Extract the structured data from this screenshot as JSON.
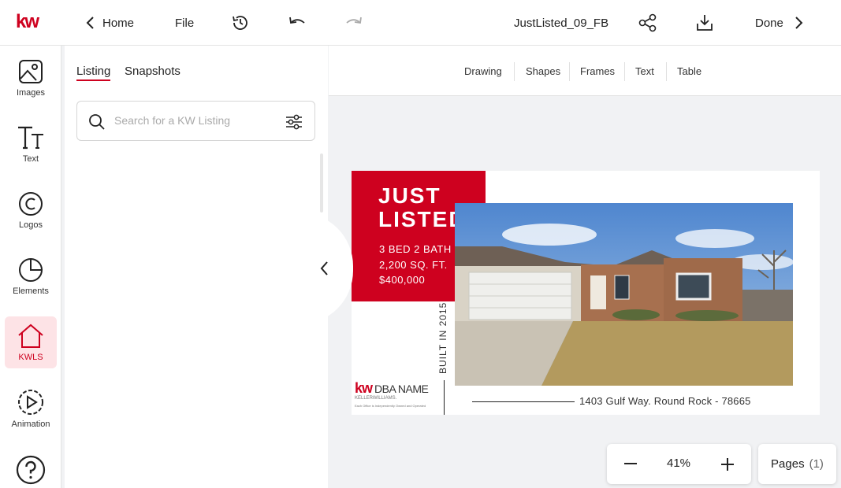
{
  "brand": {
    "logo": "kw",
    "accent": "#ce011f"
  },
  "topbar": {
    "home_label": "Home",
    "file_label": "File",
    "document_name": "JustListed_09_FB",
    "done_label": "Done"
  },
  "rail": {
    "items": [
      {
        "label": "Images",
        "icon": "image-icon"
      },
      {
        "label": "Text",
        "icon": "text-icon"
      },
      {
        "label": "Logos",
        "icon": "copyright-icon"
      },
      {
        "label": "Elements",
        "icon": "pie-icon"
      },
      {
        "label": "KWLS",
        "icon": "home-icon",
        "active": true
      },
      {
        "label": "Animation",
        "icon": "play-icon"
      },
      {
        "label": "",
        "icon": "help-icon"
      }
    ]
  },
  "panel": {
    "tabs": [
      {
        "label": "Listing",
        "active": true
      },
      {
        "label": "Snapshots"
      }
    ],
    "search_placeholder": "Search for a KW Listing"
  },
  "canvas_toolbar": {
    "items": [
      "Drawing",
      "Shapes",
      "Frames",
      "Text",
      "Table"
    ]
  },
  "flyer": {
    "headline1": "JUST",
    "headline2": "LISTED",
    "details": [
      "3 BED 2 BATH",
      "2,200 SQ. FT.",
      "$400,000"
    ],
    "built": "BUILT IN 2015",
    "address": "1403 Gulf Way. Round Rock - 78665",
    "logo_kw": "kw",
    "dba_name": "DBA NAME",
    "logo_sub": "KELLERWILLIAMS.",
    "logo_fine": "Each Office is Independently Owned and Operated"
  },
  "zoom": {
    "value": "41%"
  },
  "pages": {
    "label": "Pages",
    "count": "(1)"
  }
}
